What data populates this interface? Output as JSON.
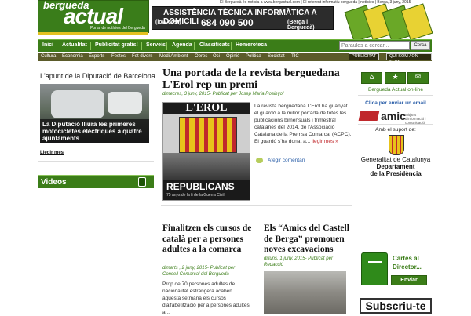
{
  "header": {
    "logo_top": "bergueda",
    "logo_main": "actual",
    "logo_sub": "Portal de notícies del Berguedà",
    "topline": "El Berguedà és notícia a www.bergactual.com | El referent informatiu berguedà | notícies | Berga, 3 juny, 2015",
    "banner_line1": "ASSISTÈNCIA TÈCNICA INFORMÀTICA A DOMICILI",
    "banner_lowcost": "(low cost)",
    "banner_phone": "684 090 500",
    "banner_place": "(Berga i Berguedà)"
  },
  "nav": {
    "items": [
      "Inici",
      "Actualitat",
      "Publicitat gratis!",
      "Serveis",
      "Agenda",
      "Classificats",
      "Hemeroteca"
    ],
    "search_placeholder": "Paraules a cercar...",
    "search_button": "Cerca"
  },
  "subnav": {
    "items": [
      "Cultura",
      "Economia",
      "Esports",
      "Festes",
      "Fet divers",
      "Medi Ambient",
      "Obres",
      "Oci",
      "Opinió",
      "Política",
      "Societat",
      "TIC"
    ],
    "pill1": "PUBLICITAT",
    "pill2": "QUI SOM / ON SOM"
  },
  "left": {
    "title": "L'apunt de la Diputació de Barcelona",
    "caption": "La Diputació lliura les primeres motocicletes elèctriques a quatre ajuntaments",
    "more": "Llegir més",
    "videos": "Videos"
  },
  "main": {
    "title": "Una portada de la revista berguedana L'Erol rep un premi",
    "meta": "dimecres, 3 juny, 2015- Publicat per Josep Maria Rosinyol",
    "cover_head": "L'EROL",
    "cover_foot1": "REPUBLICANS",
    "cover_foot2": "75 anys de la fi de la Guerra Civil",
    "body": "La revista berguedana L'Erol ha guanyat el guardó a la millor portada de totes les publicacions bimensuals i trimestral catalanes del 2014, de l'Associació Catalana de la Premsa Comarcal (ACPC). El guardó s'ha donat a...",
    "body_link": "llegir més »",
    "comments": "Afegir comentari"
  },
  "articles": [
    {
      "title": "Finalitzen els cursos de català per a persones adultes a la comarca",
      "meta": "dimarts , 2 juny, 2015- Publicat per Consell Comarcal del Berguedà",
      "body": "Prop de 70 persones adultes de nacionalitat estrangera acaben aquesta setmana els cursos d'alfabetització per a persones adultes a..."
    },
    {
      "title": "Els “Amics del Castell de Berga” promouen noves excavacions",
      "meta": "dilluns, 1 juny, 2015- Publicat per Redacció"
    }
  ],
  "right": {
    "online": "Berguedà Actual on-line",
    "email_link": "Clica per enviar un email",
    "amic": "amic",
    "amic_sub": "mitjans d'informació i comunicació",
    "support": "Amb el suport de:",
    "gen1": "Generalitat de Catalunya",
    "gen2": "Departament",
    "gen3": "de la Presidència",
    "cartes": "Cartes al Director...",
    "enviar": "Enviar",
    "subs": "Subscriu-te"
  }
}
